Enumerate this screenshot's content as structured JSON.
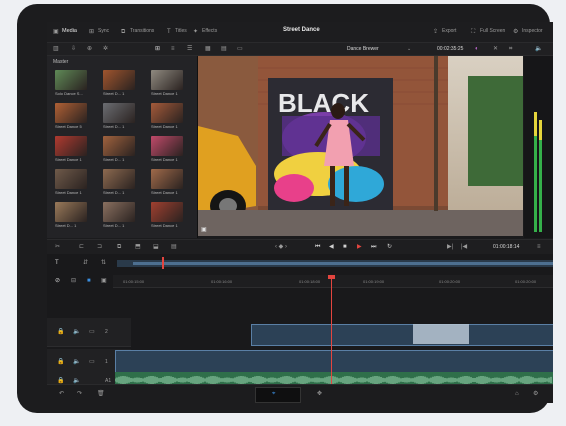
{
  "app": {
    "project_title": "Street Dance"
  },
  "top_tabs": [
    {
      "label": "Media",
      "icon": "media-icon"
    },
    {
      "label": "Sync",
      "icon": "sync-icon"
    },
    {
      "label": "Transitions",
      "icon": "transitions-icon"
    },
    {
      "label": "Titles",
      "icon": "titles-icon"
    },
    {
      "label": "Effects",
      "icon": "effects-icon"
    }
  ],
  "top_right": [
    {
      "label": "Export",
      "icon": "export-icon"
    },
    {
      "label": "Full Screen",
      "icon": "fullscreen-icon"
    },
    {
      "label": "Inspector",
      "icon": "inspector-icon"
    }
  ],
  "viewer": {
    "clip_name": "Dance Brewer",
    "timecode": "00:02:35:25",
    "graffiti_text": "BLACK"
  },
  "media_pool": {
    "bin_name": "Master",
    "clips": [
      {
        "label": "Solo Dance S...",
        "color": "#5f8a57"
      },
      {
        "label": "Street D... 1",
        "color": "#a0552e"
      },
      {
        "label": "Street Dance 1",
        "color": "#8f8a80"
      },
      {
        "label": "Street Dance 5",
        "color": "#b06035"
      },
      {
        "label": "Street D... 1",
        "color": "#6b6d72"
      },
      {
        "label": "Street Dance 1",
        "color": "#a45a3a"
      },
      {
        "label": "Street Dance 1",
        "color": "#b03a30"
      },
      {
        "label": "Street D... 1",
        "color": "#a0623e"
      },
      {
        "label": "Street Dance 1",
        "color": "#c04a6a"
      },
      {
        "label": "Street Dance 1",
        "color": "#6f5a4a"
      },
      {
        "label": "Street D... 1",
        "color": "#8d6a50"
      },
      {
        "label": "Street Dance 1",
        "color": "#a06a4a"
      },
      {
        "label": "Street D... 1",
        "color": "#9a7a5a"
      },
      {
        "label": "Street D... 1",
        "color": "#8a7060"
      },
      {
        "label": "Street Dance 1",
        "color": "#a04030"
      }
    ]
  },
  "transport": {
    "timecode": "01:00:18:14"
  },
  "timeline": {
    "ruler": [
      "01:00:15:00",
      "01:00:16:00",
      "01:00:18:00",
      "01:00:19:00",
      "01:00:20:00",
      "01:00:20:00"
    ],
    "tracks": [
      {
        "number": "2",
        "type": "video"
      },
      {
        "number": "1",
        "type": "video"
      },
      {
        "number": "A1",
        "type": "audio"
      }
    ]
  },
  "colors": {
    "accent": "#e3453f",
    "clip": "#2c4156",
    "audio": "#3f8a5e"
  }
}
